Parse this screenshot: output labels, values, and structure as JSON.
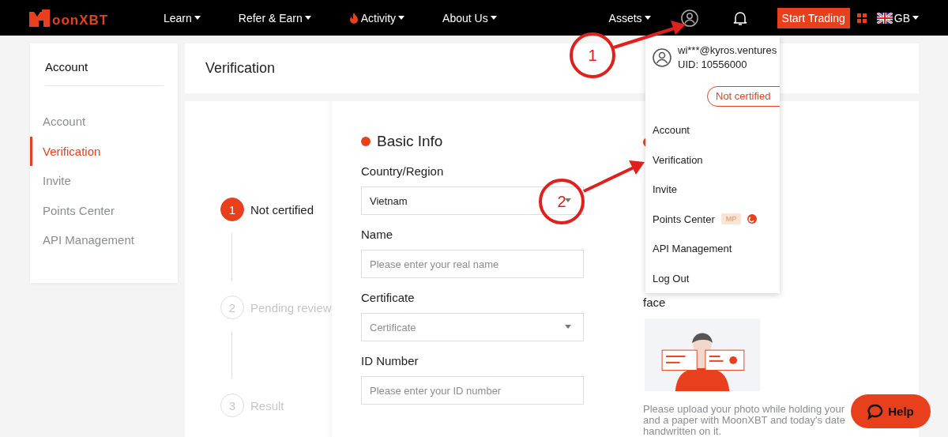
{
  "nav": {
    "logo_text": "oonXBT",
    "items": [
      {
        "label": "Learn",
        "kind": "plain"
      },
      {
        "label": "Refer & Earn",
        "kind": "plain"
      },
      {
        "label": "Activity",
        "kind": "hot"
      },
      {
        "label": "About Us",
        "kind": "plain"
      }
    ],
    "assets": "Assets",
    "start_trading": "Start Trading",
    "language": "GB"
  },
  "sidebar": {
    "title": "Account",
    "items": [
      {
        "label": "Account",
        "selected": false
      },
      {
        "label": "Verification",
        "selected": true
      },
      {
        "label": "Invite",
        "selected": false
      },
      {
        "label": "Points Center",
        "selected": false
      },
      {
        "label": "API Management",
        "selected": false
      }
    ]
  },
  "page_title": "Verification",
  "steps": [
    {
      "number": "1",
      "label": "Not certified",
      "selected": true
    },
    {
      "number": "2",
      "label": "Pending review",
      "selected": false
    },
    {
      "number": "3",
      "label": "Result",
      "selected": false
    }
  ],
  "basic_info": {
    "title": "Basic Info",
    "fields": [
      {
        "label": "Country/Region",
        "kind": "select",
        "value": "Vietnam"
      },
      {
        "label": "Name",
        "kind": "text",
        "placeholder": "Please enter your real name"
      },
      {
        "label": "Certificate",
        "kind": "select",
        "placeholder": "Certificate"
      },
      {
        "label": "ID Number",
        "kind": "text",
        "placeholder": "Please enter your ID number"
      }
    ]
  },
  "photo_section": {
    "title_fragment": "face",
    "picture": {
      "kind": "picture"
    },
    "description_lines": [
      "Please upload your photo while holding your",
      "and a paper with MoonXBT and today's date",
      "handwritten on it."
    ]
  },
  "user_menu": {
    "email": "wi***@kyros.ventures",
    "uid": "UID: 10556000",
    "status": "Not certified",
    "items": [
      {
        "label": "Account"
      },
      {
        "label": "Verification"
      },
      {
        "label": "Invite"
      },
      {
        "label": "Points Center",
        "badge": "MP",
        "dot": true
      },
      {
        "label": "API Management"
      },
      {
        "label": "Log Out"
      }
    ]
  },
  "annotations": [
    {
      "label": "1"
    },
    {
      "label": "2"
    }
  ],
  "help_button": "Help"
}
